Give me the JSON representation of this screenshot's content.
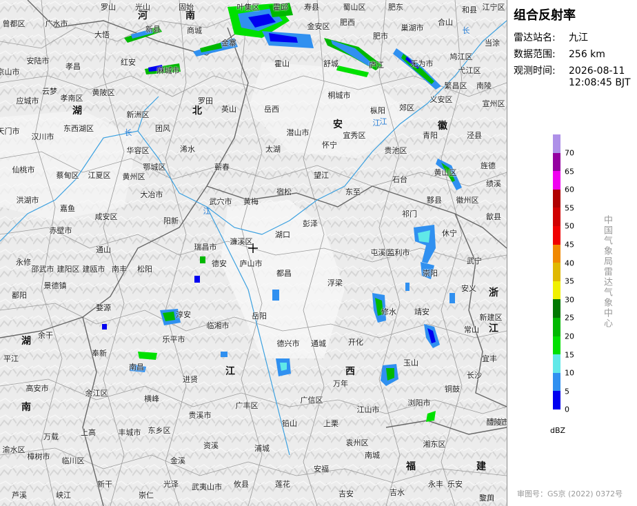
{
  "panel": {
    "title": "组合反射率",
    "station_label": "雷达站名:",
    "station_value": "九江",
    "range_label": "数据范围:",
    "range_value": "256 km",
    "time_label": "观测时间:",
    "time_date": "2026-08-11",
    "time_clock": "12:08:45 BJT",
    "center_text": "中国气象局雷达气象中心",
    "unit": "dBZ",
    "approval": "审图号：GS京 (2022) 0372号"
  },
  "legend": [
    {
      "value": "70",
      "color": "#ae90e8"
    },
    {
      "value": "65",
      "color": "#9400a0"
    },
    {
      "value": "60",
      "color": "#f000f0"
    },
    {
      "value": "55",
      "color": "#b00000"
    },
    {
      "value": "50",
      "color": "#d00000"
    },
    {
      "value": "45",
      "color": "#f00000"
    },
    {
      "value": "40",
      "color": "#f08800"
    },
    {
      "value": "35",
      "color": "#e0b800"
    },
    {
      "value": "30",
      "color": "#f0f000"
    },
    {
      "value": "25",
      "color": "#007800"
    },
    {
      "value": "20",
      "color": "#00b800"
    },
    {
      "value": "15",
      "color": "#00e000"
    },
    {
      "value": "10",
      "color": "#60e8e8"
    },
    {
      "value": "5",
      "color": "#3090f0"
    },
    {
      "value": "0",
      "color": "#0000f0"
    }
  ],
  "rivers": [
    {
      "id": "river-changjiang-1",
      "text": "长"
    },
    {
      "id": "river-changjiang-2",
      "text": "江"
    },
    {
      "id": "river-changjiang-3",
      "text": "江"
    },
    {
      "id": "river-changjiang-4",
      "text": "长"
    },
    {
      "id": "river-changjiang-5",
      "text": "江"
    }
  ],
  "provinces": [
    {
      "id": "hebei-he",
      "text": "河"
    },
    {
      "id": "hebei-nan",
      "text": "南"
    },
    {
      "id": "hubei-hu",
      "text": "湖"
    },
    {
      "id": "hubei-bei",
      "text": "北"
    },
    {
      "id": "anhui-an",
      "text": "安"
    },
    {
      "id": "anhui-hui",
      "text": "徽"
    },
    {
      "id": "zhejiang-zhe",
      "text": "浙"
    },
    {
      "id": "zhejiang-jiang",
      "text": "江"
    },
    {
      "id": "jiangxi-jiang",
      "text": "江"
    },
    {
      "id": "jiangxi-xi",
      "text": "西"
    },
    {
      "id": "hunan-hu",
      "text": "湖"
    },
    {
      "id": "hunan-nan",
      "text": "南"
    },
    {
      "id": "fujian-fu",
      "text": "福"
    },
    {
      "id": "fujian-jian",
      "text": "建"
    }
  ],
  "places": [
    "罗山",
    "光山",
    "固始",
    "叶集区",
    "霍邱",
    "寿县",
    "金安区",
    "蜀山区",
    "肥西",
    "肥东",
    "肥市",
    "巢湖市",
    "合山",
    "和县",
    "江宁区",
    "当涂",
    "曾都区",
    "广水市",
    "大悟",
    "新县",
    "商城",
    "金寨",
    "霍山",
    "舒城",
    "庐江",
    "无为市",
    "鸠江区",
    "弋江区",
    "繁昌区",
    "南陵",
    "宣州区",
    "京山市",
    "安陆市",
    "孝昌",
    "红安",
    "麻城市",
    "罗田",
    "英山",
    "岳西",
    "桐城市",
    "枞阳",
    "郊区",
    "义安区",
    "泾县",
    "应城市",
    "云梦",
    "孝南区",
    "黄陂区",
    "新洲区",
    "团风",
    "浠水",
    "蕲春",
    "太湖",
    "潜山市",
    "怀宁",
    "宜秀区",
    "贵池区",
    "青阳",
    "旌德",
    "天门市",
    "汉川市",
    "东西湖区",
    "华容区",
    "鄂城区",
    "黄州区",
    "大冶市",
    "武穴市",
    "黄梅",
    "宿松",
    "望江",
    "东至",
    "石台",
    "黄山区",
    "绩溪",
    "仙桃市",
    "蔡甸区",
    "江夏区",
    "洪湖市",
    "嘉鱼",
    "咸安区",
    "阳新",
    "瑞昌市",
    "濂溪区",
    "湖口",
    "彭泽",
    "祁门",
    "黟县",
    "徽州区",
    "歙县",
    "休宁",
    "赤壁市",
    "通山",
    "德安",
    "庐山市",
    "都昌",
    "浮梁",
    "屯溪区",
    "监利市",
    "崇阳",
    "武宁",
    "永修",
    "鄱阳",
    "景德镇",
    "婺源",
    "淳安",
    "临湘市",
    "岳阳",
    "通城",
    "修水",
    "靖安",
    "安义",
    "新建区",
    "余干",
    "乐平市",
    "德兴市",
    "开化",
    "常山",
    "平江",
    "奉新",
    "南昌",
    "进贤",
    "万年",
    "玉山",
    "长沙",
    "铜鼓",
    "宜丰",
    "高安市",
    "余江区",
    "横峰",
    "广丰区",
    "广信区",
    "江山市",
    "浏阳市",
    "万载",
    "上高",
    "丰城市",
    "东乡区",
    "贵溪市",
    "铅山",
    "上栗",
    "袁州区",
    "分宜",
    "渝水区",
    "樟树市",
    "临川区",
    "金溪",
    "资溪",
    "浦城",
    "醴陵市",
    "湘东区",
    "芦溪",
    "峡江",
    "新干",
    "崇仁",
    "光泽",
    "武夷山市",
    "攸县",
    "莲花",
    "安福",
    "吉安",
    "吉水",
    "永丰",
    "乐安",
    "宜黄",
    "南城",
    "黎川",
    "邵武市",
    "建阳区",
    "建瓯市",
    "南丰",
    "松阳"
  ]
}
